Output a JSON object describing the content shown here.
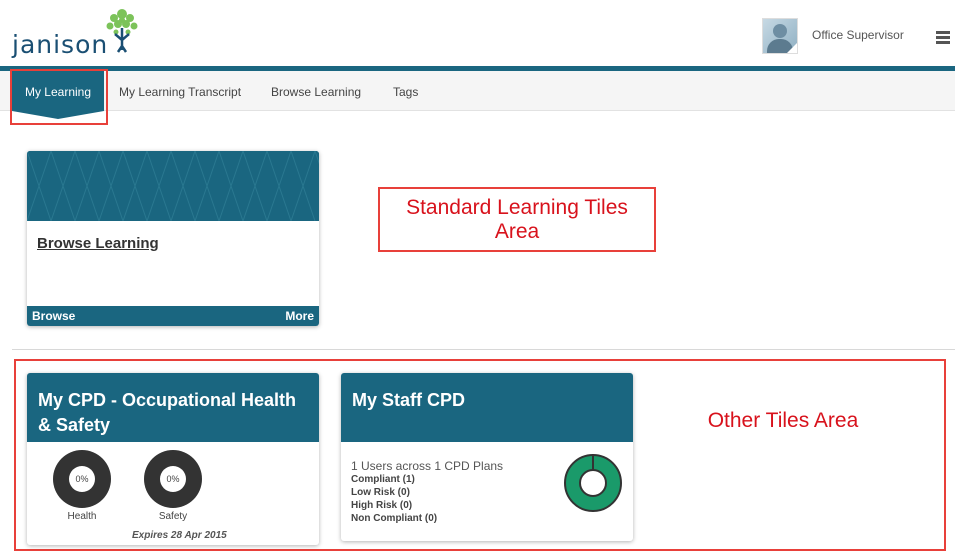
{
  "brand": {
    "logo_text": "janison"
  },
  "user": {
    "name": "Office Supervisor"
  },
  "tabs": [
    {
      "label": "My Learning",
      "active": true
    },
    {
      "label": "My Learning Transcript",
      "active": false
    },
    {
      "label": "Browse Learning",
      "active": false
    },
    {
      "label": "Tags",
      "active": false
    }
  ],
  "annotations": {
    "standard_area": "Standard Learning Tiles\nArea",
    "other_area": "Other Tiles Area"
  },
  "browse_tile": {
    "title": "Browse Learning",
    "footer_left": "Browse",
    "footer_right": "More"
  },
  "cpd_tile": {
    "title": "My CPD - Occupational Health & Safety",
    "charts": [
      {
        "label": "Health",
        "value": "0%"
      },
      {
        "label": "Safety",
        "value": "0%"
      }
    ],
    "expires": "Expires 28 Apr 2015"
  },
  "staff_cpd_tile": {
    "title": "My Staff CPD",
    "summary": "1 Users across 1 CPD Plans",
    "lines": [
      "Compliant (1)",
      "Low Risk (0)",
      "High Risk (0)",
      "Non Compliant (0)"
    ],
    "compliant_fraction": 1.0
  },
  "colors": {
    "teal": "#1a6680",
    "annotation_red": "#d8121c",
    "compliant_green": "#1a9a6a"
  }
}
